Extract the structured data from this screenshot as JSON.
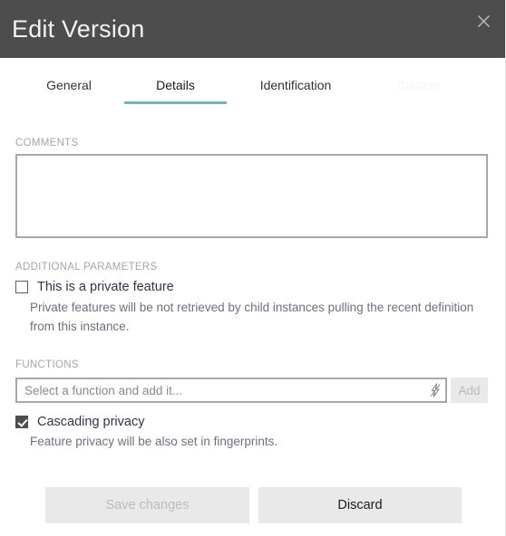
{
  "window": {
    "title": "Edit Version",
    "close_icon": "close-icon",
    "header_color": "#4d4d4d"
  },
  "tabs": {
    "accent_color": "#7eb2b2",
    "items": [
      {
        "label": "General",
        "state": "inactive"
      },
      {
        "label": "Details",
        "state": "active"
      },
      {
        "label": "Identification",
        "state": "inactive"
      },
      {
        "label": "Custom",
        "state": "disabled"
      }
    ]
  },
  "comments": {
    "label": "COMMENTS",
    "value": "",
    "placeholder": ""
  },
  "additional_parameters": {
    "label": "ADDITIONAL PARAMETERS",
    "private_feature": {
      "label": "This is a private feature",
      "checked": false,
      "help": "Private features will be not retrieved by child instances pulling the recent definition from this instance."
    }
  },
  "functions": {
    "label": "FUNCTIONS",
    "input": {
      "value": "",
      "placeholder": "Select a function and add it..."
    },
    "bolt_icon": "lightning-bolt-icon",
    "add_button": {
      "label": "Add",
      "enabled": false
    }
  },
  "cascading_privacy": {
    "label": "Cascading privacy",
    "checked": true,
    "help": "Feature privacy will be also set in fingerprints."
  },
  "footer": {
    "save_label": "Save changes",
    "save_enabled": false,
    "discard_label": "Discard",
    "discard_enabled": true
  }
}
